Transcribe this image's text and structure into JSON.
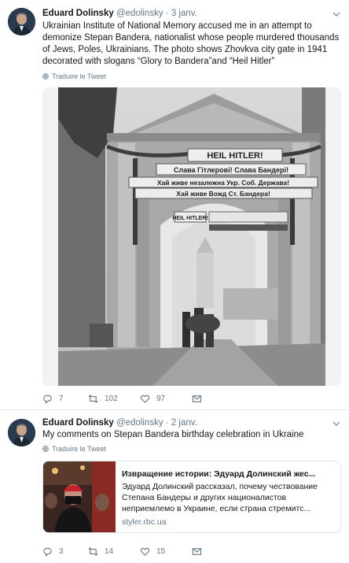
{
  "tweets": [
    {
      "author_name": "Eduard Dolinsky",
      "handle": "@edolinsky",
      "separator": "·",
      "time": "3 janv.",
      "text": "Ukrainian Institute of National Memory accused me in an attempt to demonize Stepan Bandera, nationalist whose people murdered thousands of Jews, Poles, Ukrainians. The photo shows Zhovkva city gate in 1941 decorated with slogans “Glory to Bandera”and “Heil Hitler”",
      "translate_label": "Traduire le Tweet",
      "photo": {
        "banner_top": "HEIL HITLER!",
        "banner_mid": "Слава Гітлерові!  Слава Бандері!",
        "banner_low1": "Хай живе незалежна Укр. Соб. Держава!",
        "banner_low2": "Хай живе Вожд Ст. Бандера!",
        "small_sign": "HEIL HITLER!"
      },
      "actions": {
        "replies": "7",
        "retweets": "102",
        "likes": "97"
      }
    },
    {
      "author_name": "Eduard Dolinsky",
      "handle": "@edolinsky",
      "separator": "·",
      "time": "2 janv.",
      "text": "My comments on Stepan Bandera birthday celebration in Ukraine",
      "translate_label": "Traduire le Tweet",
      "card": {
        "title": "Извращение истории: Эдуард Долинский жес...",
        "description": "Эдуард Долинский рассказал, почему чествование Степана Бандеры и других националистов неприемлемо в Украине, если страна стремитс...",
        "domain": "styler.rbc.ua"
      },
      "actions": {
        "replies": "3",
        "retweets": "14",
        "likes": "15"
      }
    }
  ],
  "colors": {
    "text": "#14171a",
    "muted": "#657786",
    "border": "#e6ecf0"
  },
  "icons": [
    "reply-icon",
    "retweet-icon",
    "like-icon",
    "dm-icon",
    "globe-icon",
    "chevron-down-icon"
  ]
}
